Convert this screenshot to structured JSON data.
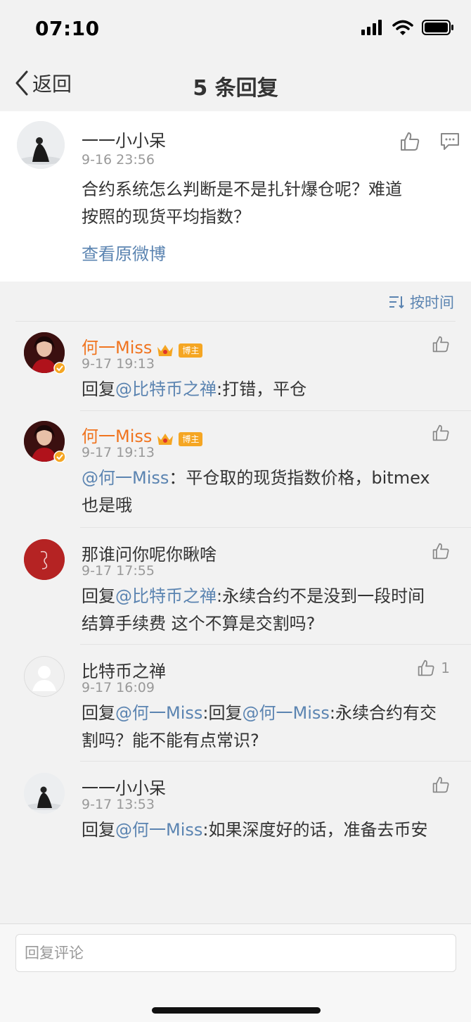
{
  "status_bar": {
    "time": "07:10"
  },
  "nav": {
    "back_label": "返回",
    "title": "5 条回复"
  },
  "main_comment": {
    "username": "一一小小呆",
    "time": "9-16 23:56",
    "text_line1": "合约系统怎么判断是不是扎针爆仓呢？难道",
    "text_line2": "按照的现货平均指数？",
    "view_original": "查看原微博"
  },
  "sort": {
    "label": "按时间"
  },
  "replies": [
    {
      "username": "何一Miss",
      "badge": "博主",
      "time": "9-17 19:13",
      "line1_prefix": "回复",
      "line1_mention": "@比特币之禅",
      "line1_rest": ":打错，平仓"
    },
    {
      "username": "何一Miss",
      "badge": "博主",
      "time": "9-17 19:13",
      "line1_mention": "@何一Miss",
      "line1_rest": "：平仓取的现货指数价格，bitmex",
      "line2": "也是哦"
    },
    {
      "username": "那谁问你呢你瞅啥",
      "time": "9-17 17:55",
      "line1_prefix": "回复",
      "line1_mention": "@比特币之禅",
      "line1_rest": ":永续合约不是没到一段时间",
      "line2": "结算手续费 这个不算是交割吗?"
    },
    {
      "username": "比特币之禅",
      "time": "9-17 16:09",
      "like_count": "1",
      "line1_prefix": "回复",
      "line1_mention": "@何一Miss",
      "line1_mid": ":回复",
      "line1_mention2": "@何一Miss",
      "line1_rest": ":永续合约有交",
      "line2": "割吗？能不能有点常识?"
    },
    {
      "username": "一一小小呆",
      "time": "9-17 13:53",
      "line1_prefix": "回复",
      "line1_mention": "@何一Miss",
      "line1_rest": ":如果深度好的话，准备去币安"
    }
  ],
  "footer": {
    "placeholder": "回复评论"
  },
  "colors": {
    "orange_name": "#f0741f",
    "link": "#5b84b1",
    "badge": "#f5a623"
  }
}
